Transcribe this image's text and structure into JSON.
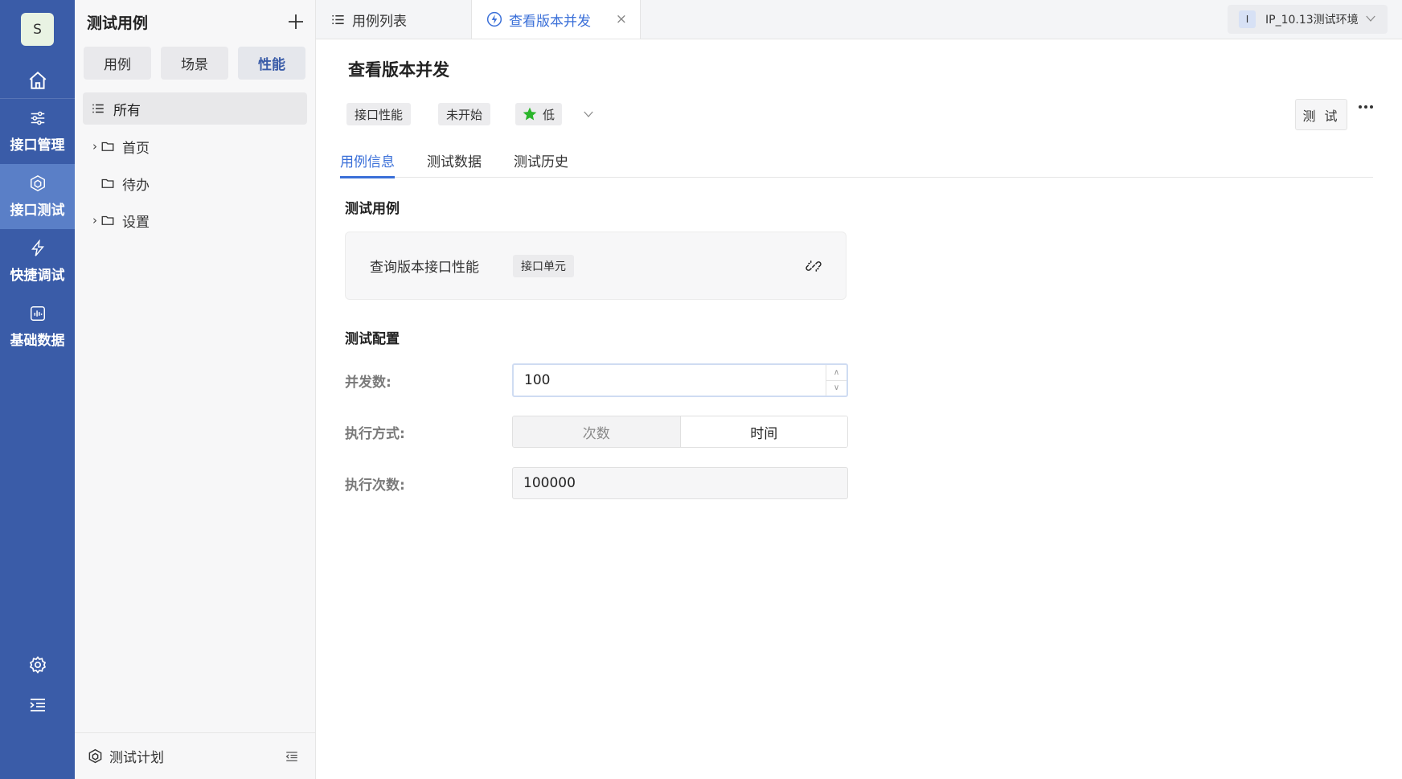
{
  "rail": {
    "avatar": "S",
    "items": [
      {
        "label": "接口管理",
        "icon": "sliders-icon"
      },
      {
        "label": "接口测试",
        "icon": "cube-icon"
      },
      {
        "label": "快捷调试",
        "icon": "lightning-icon"
      },
      {
        "label": "基础数据",
        "icon": "chart-box-icon"
      }
    ]
  },
  "tree": {
    "title": "测试用例",
    "segments": [
      "用例",
      "场景",
      "性能"
    ],
    "all_label": "所有",
    "nodes": [
      {
        "label": "首页",
        "expandable": true
      },
      {
        "label": "待办",
        "expandable": false
      },
      {
        "label": "设置",
        "expandable": true
      }
    ],
    "footer_label": "测试计划"
  },
  "tabs": {
    "list_label": "用例列表",
    "active_label": "查看版本并发",
    "close_glyph": "×"
  },
  "env": {
    "badge": "I",
    "label": "IP_10.13测试环境"
  },
  "page": {
    "title": "查看版本并发",
    "tag_type": "接口性能",
    "tag_status": "未开始",
    "priority": "低",
    "priority_color": "#2bb52b",
    "test_button": "测 试"
  },
  "subtabs": [
    "用例信息",
    "测试数据",
    "测试历史"
  ],
  "case_section": {
    "heading": "测试用例",
    "case_name": "查询版本接口性能",
    "case_tag": "接口单元"
  },
  "config_section": {
    "heading": "测试配置",
    "concurrency_label": "并发数:",
    "concurrency_value": "100",
    "mode_label": "执行方式:",
    "mode_options": [
      "次数",
      "时间"
    ],
    "count_label": "执行次数:",
    "count_value": "100000"
  },
  "colors": {
    "rail_bg": "#3a5ca8",
    "accent": "#3a6fd8"
  }
}
